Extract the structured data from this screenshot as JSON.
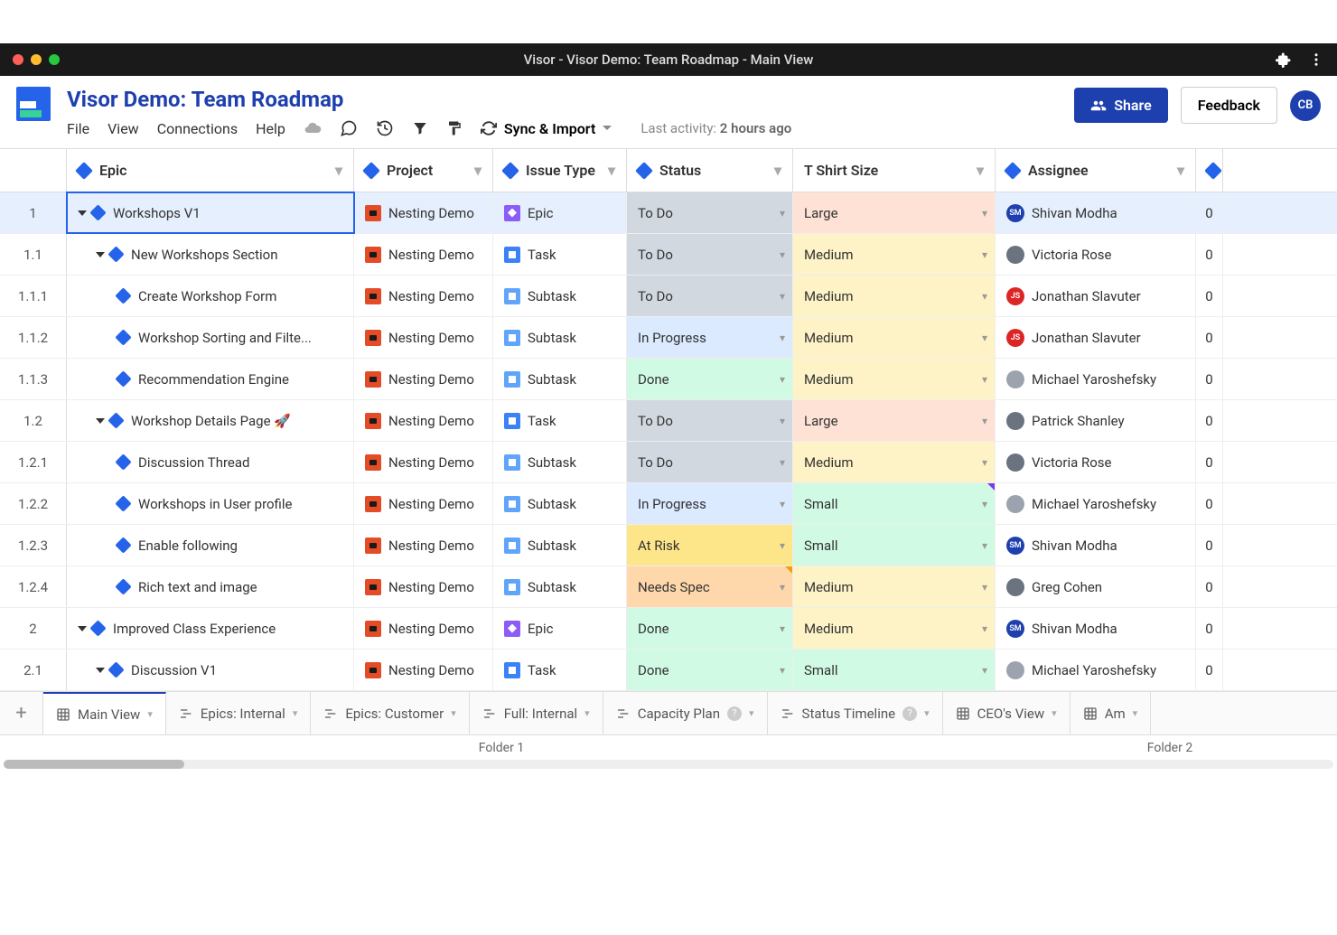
{
  "window_title": "Visor - Visor Demo: Team Roadmap - Main View",
  "doc_title": "Visor Demo: Team Roadmap",
  "header": {
    "share": "Share",
    "feedback": "Feedback",
    "avatar": "CB"
  },
  "menubar": {
    "file": "File",
    "view": "View",
    "connections": "Connections",
    "help": "Help",
    "sync": "Sync & Import",
    "last_activity_label": "Last activity:",
    "last_activity_value": "2 hours ago"
  },
  "columns": {
    "epic": "Epic",
    "project": "Project",
    "issue_type": "Issue Type",
    "status": "Status",
    "tshirt": "T Shirt Size",
    "assignee": "Assignee"
  },
  "rows": [
    {
      "num": "1",
      "indent": 0,
      "caret": true,
      "epic": "Workshops V1",
      "project": "Nesting Demo",
      "type": "Epic",
      "type_k": "epic-t",
      "status": "To Do",
      "status_k": "status-todo",
      "size": "Large",
      "size_k": "size-large",
      "assignee": "Shivan Modha",
      "av_bg": "#1e40af",
      "av_txt": "SM",
      "selected": true,
      "last": "0"
    },
    {
      "num": "1.1",
      "indent": 1,
      "caret": true,
      "epic": "New Workshops Section",
      "project": "Nesting Demo",
      "type": "Task",
      "type_k": "task-t",
      "status": "To Do",
      "status_k": "status-todo",
      "size": "Medium",
      "size_k": "size-medium",
      "assignee": "Victoria Rose",
      "av_bg": "#6b7280",
      "av_txt": "",
      "last": "0"
    },
    {
      "num": "1.1.1",
      "indent": 2,
      "caret": false,
      "epic": "Create Workshop Form",
      "project": "Nesting Demo",
      "type": "Subtask",
      "type_k": "sub-t",
      "status": "To Do",
      "status_k": "status-todo",
      "size": "Medium",
      "size_k": "size-medium",
      "assignee": "Jonathan Slavuter",
      "av_bg": "#dc2626",
      "av_txt": "JS",
      "last": "0"
    },
    {
      "num": "1.1.2",
      "indent": 2,
      "caret": false,
      "epic": "Workshop Sorting and Filte...",
      "project": "Nesting Demo",
      "type": "Subtask",
      "type_k": "sub-t",
      "status": "In Progress",
      "status_k": "status-progress",
      "size": "Medium",
      "size_k": "size-medium",
      "assignee": "Jonathan Slavuter",
      "av_bg": "#dc2626",
      "av_txt": "JS",
      "last": "0"
    },
    {
      "num": "1.1.3",
      "indent": 2,
      "caret": false,
      "epic": "Recommendation Engine",
      "project": "Nesting Demo",
      "type": "Subtask",
      "type_k": "sub-t",
      "status": "Done",
      "status_k": "status-done",
      "size": "Medium",
      "size_k": "size-medium",
      "assignee": "Michael Yaroshefsky",
      "av_bg": "#9ca3af",
      "av_txt": "",
      "last": "0"
    },
    {
      "num": "1.2",
      "indent": 1,
      "caret": true,
      "epic": "Workshop Details Page 🚀",
      "project": "Nesting Demo",
      "type": "Task",
      "type_k": "task-t",
      "status": "To Do",
      "status_k": "status-todo",
      "size": "Large",
      "size_k": "size-large",
      "assignee": "Patrick Shanley",
      "av_bg": "#6b7280",
      "av_txt": "",
      "last": "0"
    },
    {
      "num": "1.2.1",
      "indent": 2,
      "caret": false,
      "epic": "Discussion Thread",
      "project": "Nesting Demo",
      "type": "Subtask",
      "type_k": "sub-t",
      "status": "To Do",
      "status_k": "status-todo",
      "size": "Medium",
      "size_k": "size-medium",
      "assignee": "Victoria Rose",
      "av_bg": "#6b7280",
      "av_txt": "",
      "last": "0"
    },
    {
      "num": "1.2.2",
      "indent": 2,
      "caret": false,
      "epic": "Workshops in User profile",
      "project": "Nesting Demo",
      "type": "Subtask",
      "type_k": "sub-t",
      "status": "In Progress",
      "status_k": "status-progress",
      "size": "Small",
      "size_k": "size-small",
      "size_flag": "purple",
      "assignee": "Michael Yaroshefsky",
      "av_bg": "#9ca3af",
      "av_txt": "",
      "last": "0"
    },
    {
      "num": "1.2.3",
      "indent": 2,
      "caret": false,
      "epic": "Enable following",
      "project": "Nesting Demo",
      "type": "Subtask",
      "type_k": "sub-t",
      "status": "At Risk",
      "status_k": "status-risk",
      "size": "Small",
      "size_k": "size-small",
      "assignee": "Shivan Modha",
      "av_bg": "#1e40af",
      "av_txt": "SM",
      "last": "0"
    },
    {
      "num": "1.2.4",
      "indent": 2,
      "caret": false,
      "epic": "Rich text and image",
      "project": "Nesting Demo",
      "type": "Subtask",
      "type_k": "sub-t",
      "status": "Needs Spec",
      "status_k": "status-spec",
      "status_flag": "orange",
      "size": "Medium",
      "size_k": "size-medium",
      "assignee": "Greg Cohen",
      "av_bg": "#6b7280",
      "av_txt": "",
      "last": "0"
    },
    {
      "num": "2",
      "indent": 0,
      "caret": true,
      "epic": "Improved Class Experience",
      "project": "Nesting Demo",
      "type": "Epic",
      "type_k": "epic-t",
      "status": "Done",
      "status_k": "status-done",
      "size": "Medium",
      "size_k": "size-medium",
      "assignee": "Shivan Modha",
      "av_bg": "#1e40af",
      "av_txt": "SM",
      "last": "0"
    },
    {
      "num": "2.1",
      "indent": 1,
      "caret": true,
      "epic": "Discussion V1",
      "project": "Nesting Demo",
      "type": "Task",
      "type_k": "task-t",
      "status": "Done",
      "status_k": "status-done",
      "size": "Small",
      "size_k": "size-small",
      "assignee": "Michael Yaroshefsky",
      "av_bg": "#9ca3af",
      "av_txt": "",
      "last": "0"
    }
  ],
  "tabs": [
    {
      "label": "Main View",
      "icon": "grid",
      "active": true
    },
    {
      "label": "Epics: Internal",
      "icon": "gantt"
    },
    {
      "label": "Epics: Customer",
      "icon": "gantt"
    },
    {
      "label": "Full: Internal",
      "icon": "gantt"
    },
    {
      "label": "Capacity Plan",
      "icon": "gantt",
      "help": true
    },
    {
      "label": "Status Timeline",
      "icon": "gantt",
      "help": true
    },
    {
      "label": "CEO's View",
      "icon": "grid"
    },
    {
      "label": "Am",
      "icon": "grid",
      "cut": true
    }
  ],
  "folders": {
    "f1": "Folder 1",
    "f2": "Folder 2"
  }
}
